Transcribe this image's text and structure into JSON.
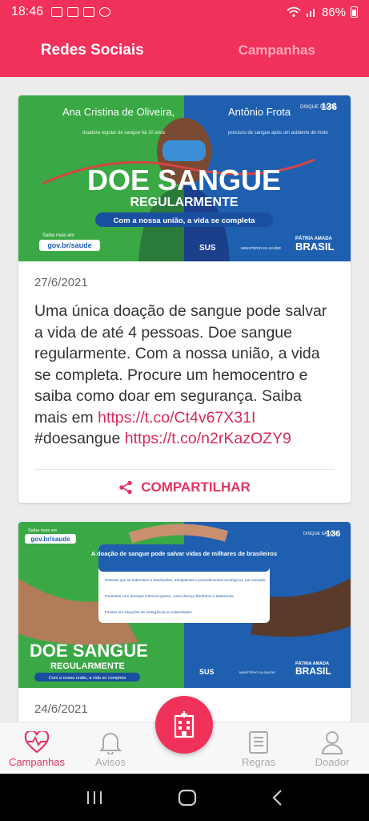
{
  "status_bar": {
    "time": "18:46",
    "battery": "86%"
  },
  "header": {
    "tabs": [
      {
        "label": "Redes Sociais",
        "active": true
      },
      {
        "label": "Campanhas",
        "active": false
      }
    ]
  },
  "posts": [
    {
      "banner": {
        "left_name": "Ana Cristina de Oliveira,",
        "left_caption": "doadora regular de sangue há 10 anos",
        "right_name": "Antônio Frota",
        "right_caption": "precisou de sangue após um acidente de moto",
        "headline": "DOE SANGUE",
        "subheadline": "REGULARMENTE",
        "slogan": "Com a nossa união, a vida se completa",
        "disque": "DISQUE SAÚDE",
        "disque_number": "136",
        "gov": "gov.br/saude",
        "gov_small": "Saiba mais em",
        "sus": "SUS",
        "ministerio": "MINISTÉRIO DA SAÚDE",
        "patria": "PÁTRIA AMADA",
        "brasil": "BRASIL"
      },
      "date": "27/6/2021",
      "text": "Uma única doação de sangue pode salvar a vida de até 4 pessoas. Doe sangue regularmente. Com a nossa união, a vida se completa. Procure um hemocentro e saiba como doar em segurança. Saiba mais em ",
      "link1": "https://t.co/Ct4v67X31I",
      "hashtag": " #doesangue ",
      "link2": "https://t.co/n2rKazOZY9",
      "share_label": "COMPARTILHAR"
    },
    {
      "banner": {
        "box_title": "A doação de sangue pode salvar vidas de milhares de brasileiros",
        "bullet1": "Pessoas que se submetem a transfusões, transplantes e procedimentos oncológicos, por exemplo.",
        "bullet2": "Pacientes com doenças crônicas graves, como doença falciforme e talassemia.",
        "bullet3": "Feridos em situações de emergência ou calamidades.",
        "headline": "DOE SANGUE",
        "subheadline": "REGULARMENTE",
        "slogan": "Com a nossa união, a vida se completa",
        "disque": "DISQUE SAÚDE",
        "disque_number": "136",
        "gov": "gov.br/saude",
        "gov_small": "Saiba mais em",
        "sus": "SUS",
        "ministerio": "MINISTÉRIO DA SAÚDE",
        "patria": "PÁTRIA AMADA",
        "brasil": "BRASIL"
      },
      "date": "24/6/2021"
    }
  ],
  "bottom_nav": {
    "items": [
      {
        "label": "Campanhas",
        "icon": "heart-pulse-icon",
        "active": true
      },
      {
        "label": "Avisos",
        "icon": "bell-icon",
        "active": false
      },
      {
        "label": "Regras",
        "icon": "document-icon",
        "active": false
      },
      {
        "label": "Doador",
        "icon": "person-icon",
        "active": false
      }
    ],
    "fab_icon": "hospital-icon"
  },
  "colors": {
    "brand": "#f0315a",
    "accent_text": "#e33462",
    "link": "#d62a5a",
    "banner_green": "#3aa845",
    "banner_blue": "#1f5fb0"
  }
}
